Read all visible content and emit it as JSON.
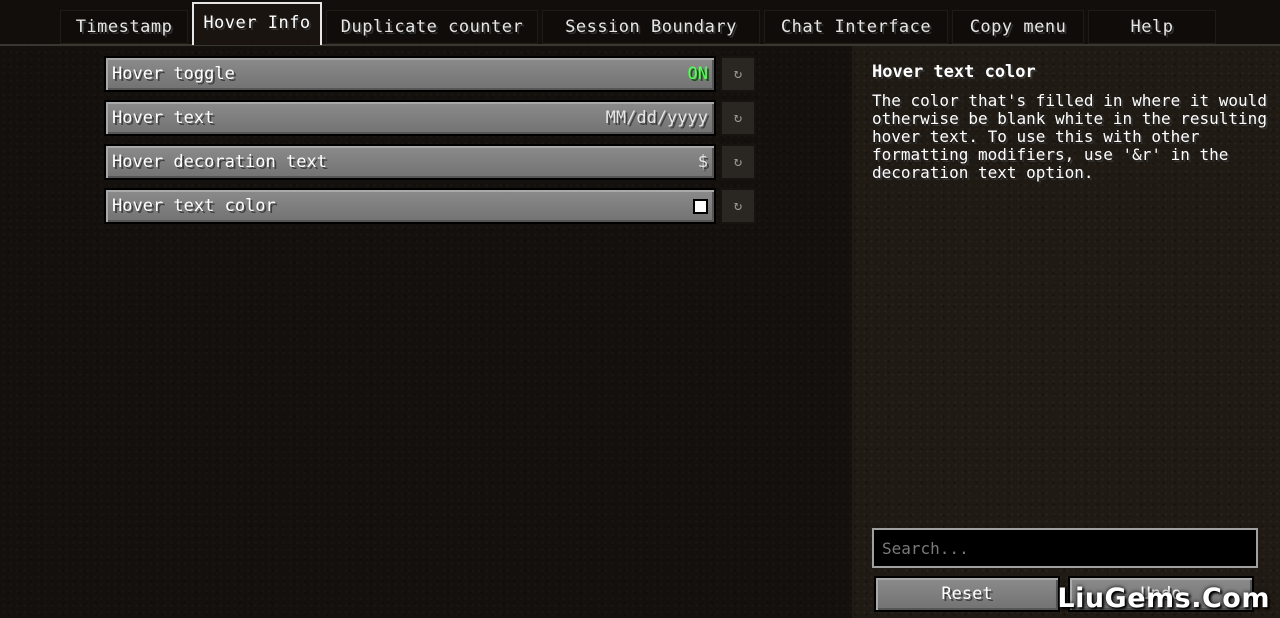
{
  "tabs": [
    {
      "label": "Timestamp"
    },
    {
      "label": "Hover Info",
      "active": true
    },
    {
      "label": "Duplicate counter"
    },
    {
      "label": "Session Boundary"
    },
    {
      "label": "Chat Interface"
    },
    {
      "label": "Copy menu"
    },
    {
      "label": "Help"
    }
  ],
  "options": [
    {
      "label": "Hover toggle",
      "value": "ON"
    },
    {
      "label": "Hover text",
      "value": "MM/dd/yyyy"
    },
    {
      "label": "Hover decoration text",
      "value": "$"
    },
    {
      "label": "Hover text color",
      "value_color": "#ffffff"
    }
  ],
  "reset_icon": "↻",
  "description": {
    "title": "Hover text color",
    "body": "The color that's filled in where it would otherwise be blank white in the resulting hover text. To use this with other formatting modifiers, use '&r' in the decoration text option."
  },
  "search": {
    "placeholder": "Search..."
  },
  "buttons": {
    "reset": "Reset",
    "second": "Undo"
  },
  "watermark": "LiuGems.Com",
  "colors": {
    "on": "#55ff55",
    "button": "#8b8b8b",
    "background": "#201a14"
  }
}
